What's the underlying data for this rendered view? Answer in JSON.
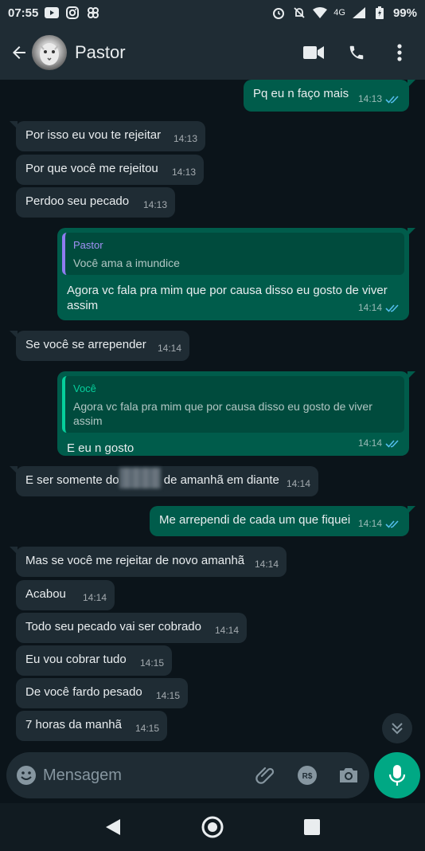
{
  "status": {
    "time": "07:55",
    "network": "4G",
    "battery": "99%"
  },
  "header": {
    "contact_name": "Pastor",
    "icons": [
      "back-arrow-icon",
      "avatar",
      "video-call-icon",
      "voice-call-icon",
      "more-options-icon"
    ]
  },
  "messages": [
    {
      "side": "out",
      "text": "Pq eu n faço mais",
      "time": "14:13",
      "read": true
    },
    {
      "side": "in",
      "text": "Por isso eu vou te rejeitar",
      "time": "14:13"
    },
    {
      "side": "in",
      "text": "Por que você me rejeitou",
      "time": "14:13"
    },
    {
      "side": "in",
      "text": "Perdoo seu pecado",
      "time": "14:13"
    },
    {
      "side": "out",
      "reply_to": {
        "author": "Pastor",
        "text": "Você ama a imundice"
      },
      "text": "Agora vc fala pra mim que por causa disso eu gosto de viver assim",
      "time": "14:14",
      "read": true
    },
    {
      "side": "in",
      "text": "Se você se arrepender",
      "time": "14:14"
    },
    {
      "side": "out",
      "reply_to": {
        "author": "Você",
        "text": "Agora vc fala pra mim que por causa disso eu gosto de viver assim"
      },
      "text": "E eu n gosto",
      "time": "14:14",
      "read": true
    },
    {
      "side": "in",
      "text_before": "E ser somente do",
      "text_after": "de amanhã em diante",
      "time": "14:14"
    },
    {
      "side": "out",
      "text": "Me arrependi de cada um que fiquei",
      "time": "14:14",
      "read": true
    },
    {
      "side": "in",
      "text": "Mas se você me rejeitar de novo amanhã",
      "time": "14:14"
    },
    {
      "side": "in",
      "text": "Acabou",
      "time": "14:14"
    },
    {
      "side": "in",
      "text": "Todo seu pecado vai ser cobrado",
      "time": "14:14"
    },
    {
      "side": "in",
      "text": "Eu vou cobrar tudo",
      "time": "14:15"
    },
    {
      "side": "in",
      "text": "De você fardo pesado",
      "time": "14:15"
    },
    {
      "side": "in",
      "text": "7 horas da manhã",
      "time": "14:15"
    }
  ],
  "composer": {
    "placeholder": "Mensagem"
  },
  "colors": {
    "background": "#0b141a",
    "incoming": "#1f2c34",
    "outgoing": "#005c4b",
    "accent": "#00a884",
    "read_tick": "#53bdeb"
  }
}
